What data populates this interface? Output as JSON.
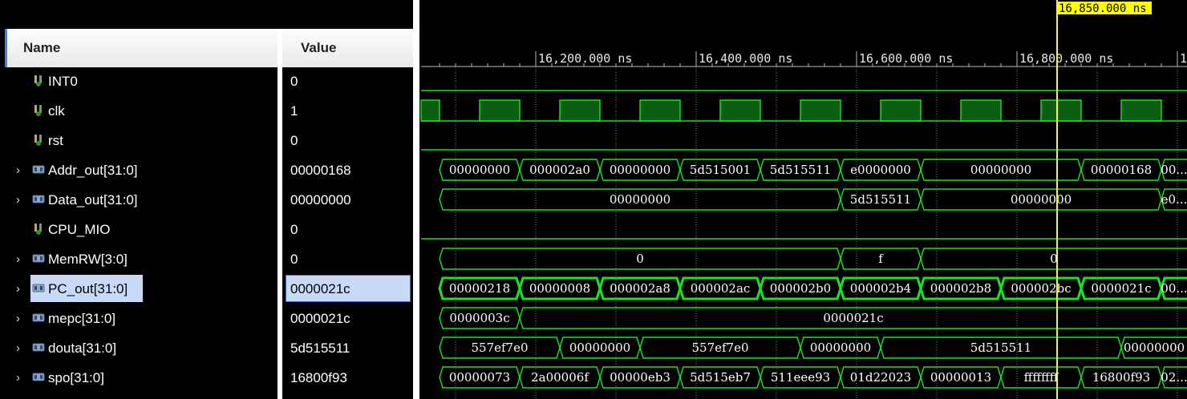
{
  "panel": {
    "name_header": "Name",
    "value_header": "Value"
  },
  "signals": [
    {
      "name": "INT0",
      "value": "0",
      "kind": "bit"
    },
    {
      "name": "clk",
      "value": "1",
      "kind": "bit"
    },
    {
      "name": "rst",
      "value": "0",
      "kind": "bit"
    },
    {
      "name": "Addr_out[31:0]",
      "value": "00000168",
      "kind": "bus"
    },
    {
      "name": "Data_out[31:0]",
      "value": "00000000",
      "kind": "bus"
    },
    {
      "name": "CPU_MIO",
      "value": "0",
      "kind": "bit"
    },
    {
      "name": "MemRW[3:0]",
      "value": "0",
      "kind": "bus"
    },
    {
      "name": "PC_out[31:0]",
      "value": "0000021c",
      "kind": "bus",
      "selected": true
    },
    {
      "name": "mepc[31:0]",
      "value": "0000021c",
      "kind": "bus"
    },
    {
      "name": "douta[31:0]",
      "value": "5d515511",
      "kind": "bus"
    },
    {
      "name": "spo[31:0]",
      "value": "16800f93",
      "kind": "bus"
    }
  ],
  "timeline": {
    "cursor_label": "16,850.000 ns",
    "cursor_time": 16850,
    "time_start": 16080,
    "time_end": 16900,
    "major_labels": [
      {
        "t": 16200,
        "text": "16,200.000 ns"
      },
      {
        "t": 16400,
        "text": "16,400.000 ns"
      },
      {
        "t": 16600,
        "text": "16,600.000 ns"
      },
      {
        "t": 16800,
        "text": "16,800.000 ns"
      },
      {
        "t": 17000,
        "text": "1"
      }
    ],
    "clock": {
      "period": 100,
      "high_start": 16130
    }
  },
  "waveforms": {
    "Addr_out": [
      {
        "a": 16080,
        "b": 16180,
        "v": "00000000"
      },
      {
        "a": 16180,
        "b": 16280,
        "v": "000002a0"
      },
      {
        "a": 16280,
        "b": 16380,
        "v": "00000000"
      },
      {
        "a": 16380,
        "b": 16480,
        "v": "5d515001"
      },
      {
        "a": 16480,
        "b": 16580,
        "v": "5d515511"
      },
      {
        "a": 16580,
        "b": 16680,
        "v": "e0000000"
      },
      {
        "a": 16680,
        "b": 16880,
        "v": "00000000"
      },
      {
        "a": 16880,
        "b": 16980,
        "v": "00000168"
      },
      {
        "a": 16980,
        "b": 17100,
        "v": "00..."
      }
    ],
    "Data_out": [
      {
        "a": 16080,
        "b": 16580,
        "v": "00000000"
      },
      {
        "a": 16580,
        "b": 16680,
        "v": "5d515511"
      },
      {
        "a": 16680,
        "b": 16980,
        "v": "00000000"
      },
      {
        "a": 16980,
        "b": 17100,
        "v": "e0..."
      }
    ],
    "MemRW": [
      {
        "a": 16080,
        "b": 16580,
        "v": "0"
      },
      {
        "a": 16580,
        "b": 16680,
        "v": "f"
      },
      {
        "a": 16680,
        "b": 17100,
        "v": "0"
      }
    ],
    "PC_out": [
      {
        "a": 16080,
        "b": 16180,
        "v": "00000218"
      },
      {
        "a": 16180,
        "b": 16280,
        "v": "00000008"
      },
      {
        "a": 16280,
        "b": 16380,
        "v": "000002a8"
      },
      {
        "a": 16380,
        "b": 16480,
        "v": "000002ac"
      },
      {
        "a": 16480,
        "b": 16580,
        "v": "000002b0"
      },
      {
        "a": 16580,
        "b": 16680,
        "v": "000002b4"
      },
      {
        "a": 16680,
        "b": 16780,
        "v": "000002b8"
      },
      {
        "a": 16780,
        "b": 16880,
        "v": "000002bc"
      },
      {
        "a": 16880,
        "b": 16980,
        "v": "0000021c"
      },
      {
        "a": 16980,
        "b": 17100,
        "v": "00..."
      }
    ],
    "mepc": [
      {
        "a": 16080,
        "b": 16180,
        "v": "0000003c"
      },
      {
        "a": 16180,
        "b": 17100,
        "v": "0000021c"
      }
    ],
    "douta": [
      {
        "a": 16080,
        "b": 16230,
        "v": "557ef7e0"
      },
      {
        "a": 16230,
        "b": 16330,
        "v": "00000000"
      },
      {
        "a": 16330,
        "b": 16530,
        "v": "557ef7e0"
      },
      {
        "a": 16530,
        "b": 16630,
        "v": "00000000"
      },
      {
        "a": 16630,
        "b": 16930,
        "v": "5d515511"
      },
      {
        "a": 16930,
        "b": 17100,
        "v": "00000000"
      }
    ],
    "spo": [
      {
        "a": 16080,
        "b": 16180,
        "v": "00000073"
      },
      {
        "a": 16180,
        "b": 16280,
        "v": "2a00006f"
      },
      {
        "a": 16280,
        "b": 16380,
        "v": "00000eb3"
      },
      {
        "a": 16380,
        "b": 16480,
        "v": "5d515eb7"
      },
      {
        "a": 16480,
        "b": 16580,
        "v": "511eee93"
      },
      {
        "a": 16580,
        "b": 16680,
        "v": "01d22023"
      },
      {
        "a": 16680,
        "b": 16780,
        "v": "00000013"
      },
      {
        "a": 16780,
        "b": 16880,
        "v": "ffffffff"
      },
      {
        "a": 16880,
        "b": 16980,
        "v": "16800f93"
      },
      {
        "a": 16980,
        "b": 17100,
        "v": "02..."
      }
    ]
  },
  "colors": {
    "wave": "#19e619",
    "clock_fill": "#0b5e12",
    "grid": "#7a7a7a",
    "cursor": "#ffff00",
    "selection": "#c8daf7"
  }
}
